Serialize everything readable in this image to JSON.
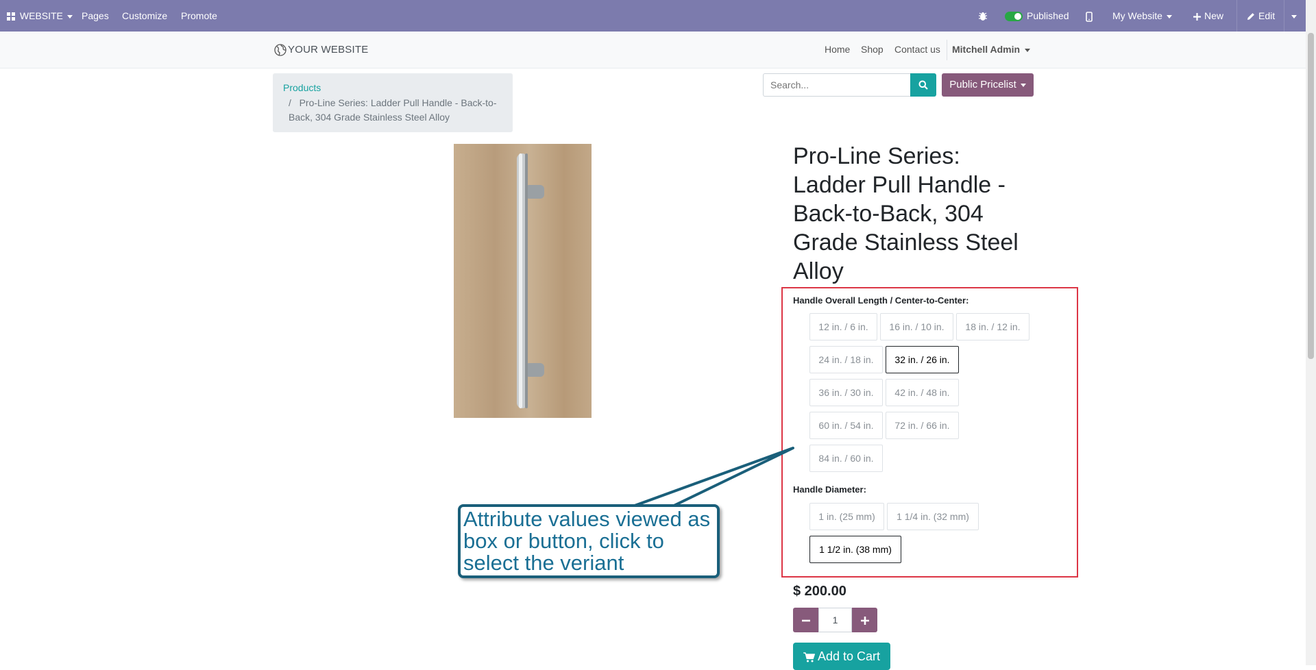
{
  "topbar": {
    "app_label": "WEBSITE",
    "menu": [
      "Pages",
      "Customize",
      "Promote"
    ],
    "published_label": "Published",
    "my_website_label": "My Website",
    "new_label": "New",
    "edit_label": "Edit"
  },
  "header": {
    "logo_text": "YOUR WEBSITE",
    "nav": [
      "Home",
      "Shop",
      "Contact us"
    ],
    "user_name": "Mitchell Admin"
  },
  "breadcrumb": {
    "link": "Products",
    "separator": "/",
    "current": "Pro-Line Series: Ladder Pull Handle - Back-to-Back, 304 Grade Stainless Steel Alloy"
  },
  "search": {
    "placeholder": "Search..."
  },
  "pricelist_label": "Public Pricelist",
  "product": {
    "title": "Pro-Line Series: Ladder Pull Handle - Back-to-Back, 304 Grade Stainless Steel Alloy",
    "attributes": [
      {
        "label": "Handle Overall Length / Center-to-Center:",
        "options": [
          {
            "label": "12 in. / 6 in.",
            "selected": false
          },
          {
            "label": "16 in. / 10 in.",
            "selected": false
          },
          {
            "label": "18 in. / 12 in.",
            "selected": false
          },
          {
            "label": "24 in. / 18 in.",
            "selected": false
          },
          {
            "label": "32 in. / 26 in.",
            "selected": true
          },
          {
            "label": "36 in. / 30 in.",
            "selected": false
          },
          {
            "label": "42 in. / 48 in.",
            "selected": false
          },
          {
            "label": "60 in. / 54 in.",
            "selected": false
          },
          {
            "label": "72 in. / 66 in.",
            "selected": false
          },
          {
            "label": "84 in. / 60 in.",
            "selected": false
          }
        ]
      },
      {
        "label": "Handle Diameter:",
        "options": [
          {
            "label": "1 in. (25 mm)",
            "selected": false
          },
          {
            "label": "1 1/4 in. (32 mm)",
            "selected": false
          },
          {
            "label": "1 1/2 in. (38 mm)",
            "selected": true
          }
        ]
      }
    ],
    "price": "$ 200.00",
    "quantity": "1",
    "add_to_cart_label": "Add to Cart"
  },
  "callout_text": " Attribute values viewed as box or button, click to select the veriant",
  "colors": {
    "topbar": "#7c7bad",
    "primary": "#875a7b",
    "teal": "#17a2a0",
    "highlight_border": "#dc3545",
    "callout": "#1a5f7a"
  },
  "icons": [
    "apps-icon",
    "bug-icon",
    "mobile-icon",
    "plus-icon",
    "pencil-icon",
    "globe-icon",
    "search-icon",
    "minus-icon",
    "cart-icon"
  ]
}
